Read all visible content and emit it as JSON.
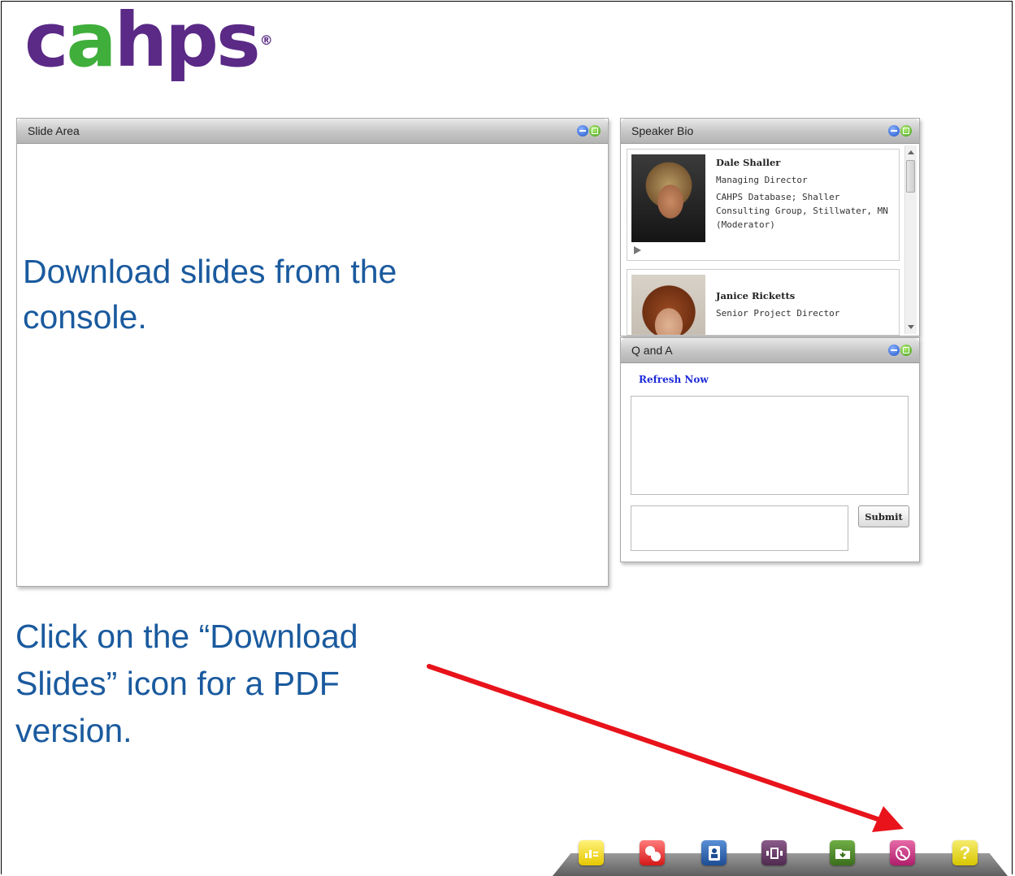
{
  "logo": {
    "text_left": "c",
    "text_accent": "a",
    "text_right": "hps",
    "trademark": "®"
  },
  "slide_area": {
    "title": "Slide Area",
    "message": "Download slides from the console."
  },
  "speaker_bio": {
    "title": "Speaker Bio",
    "speakers": [
      {
        "name": "Dale Shaller",
        "role": "Managing Director",
        "affiliation": "CAHPS Database; Shaller Consulting Group, Stillwater, MN (Moderator)"
      },
      {
        "name": "Janice Ricketts",
        "role": "Senior Project Director"
      }
    ]
  },
  "qa": {
    "title": "Q and A",
    "refresh_label": "Refresh Now",
    "submit_label": "Submit"
  },
  "instruction": "Click on the “Download Slides” icon for a PDF version.",
  "dock": {
    "icons": [
      "poll-icon",
      "qa-icon",
      "speaker-bio-icon",
      "media-player-icon",
      "download-slides-icon",
      "web-links-icon",
      "help-icon"
    ],
    "help_glyph": "?"
  },
  "colors": {
    "logo_purple": "#5a2a86",
    "logo_green": "#3fae3b",
    "text_blue": "#1a5a9e",
    "arrow_red": "#e8131b",
    "link_blue": "#1d2bd8"
  }
}
